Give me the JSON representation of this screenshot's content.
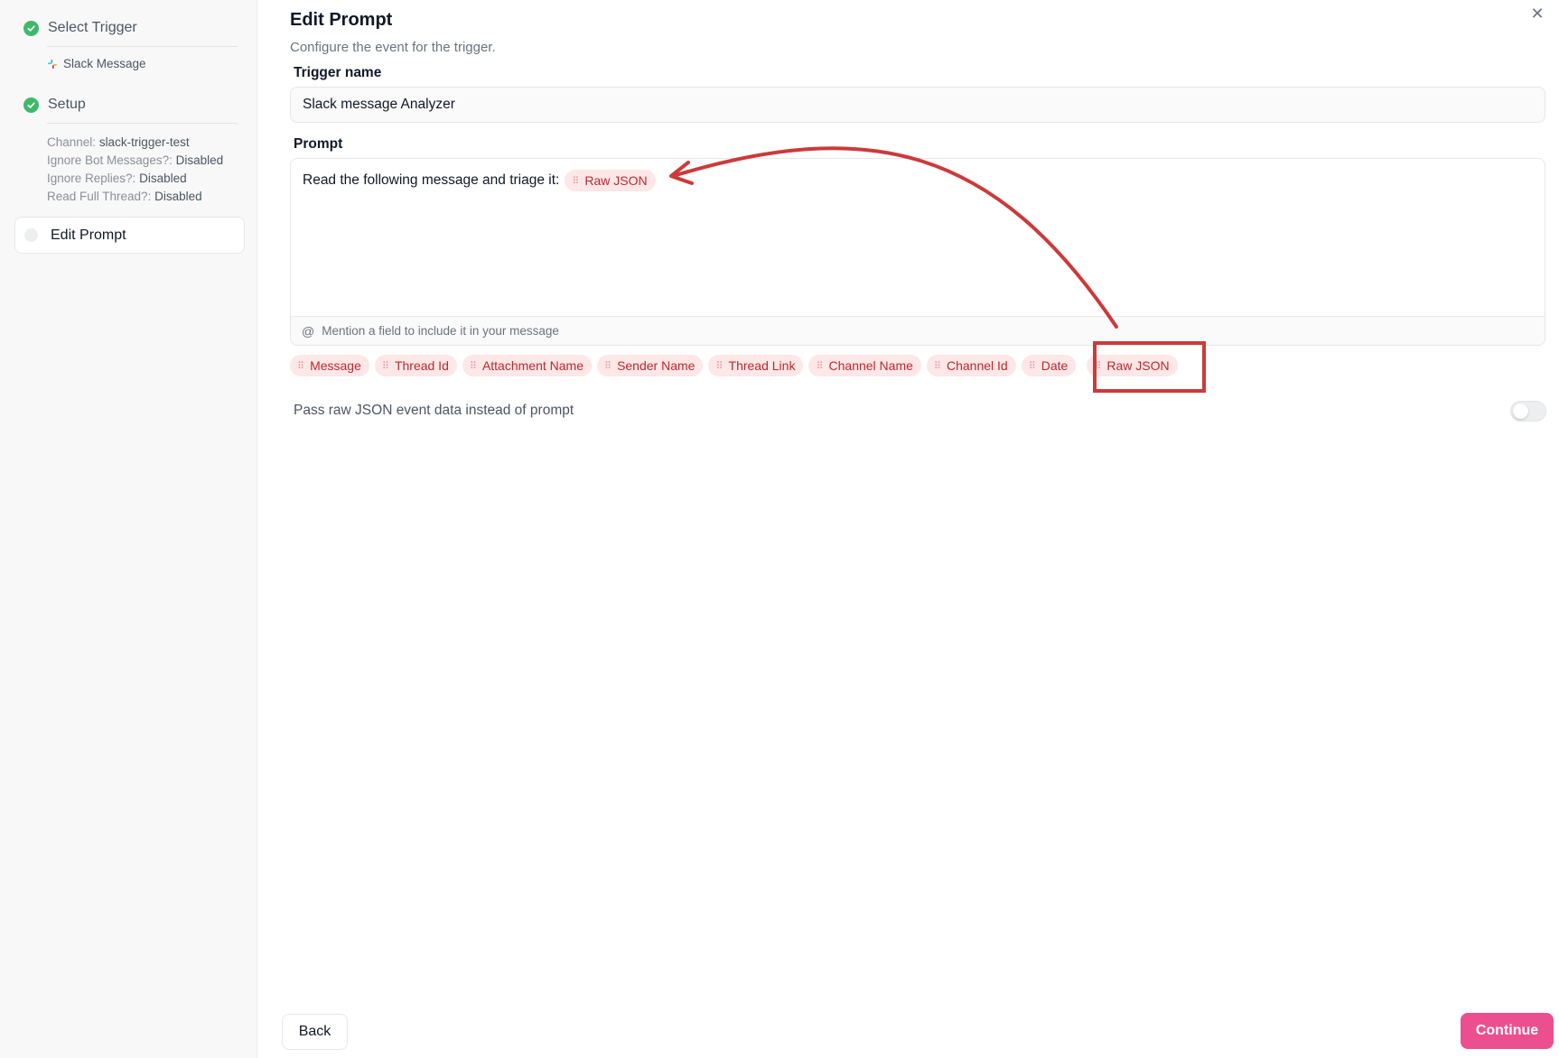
{
  "sidebar": {
    "steps": [
      {
        "label": "Select Trigger",
        "status": "complete"
      },
      {
        "label": "Setup",
        "status": "complete"
      },
      {
        "label": "Edit Prompt",
        "status": "current"
      }
    ],
    "trigger_source": "Slack Message",
    "setup_details": [
      {
        "key": "Channel:",
        "value": "slack-trigger-test"
      },
      {
        "key": "Ignore Bot Messages?:",
        "value": "Disabled"
      },
      {
        "key": "Ignore Replies?:",
        "value": "Disabled"
      },
      {
        "key": "Read Full Thread?:",
        "value": "Disabled"
      }
    ]
  },
  "main": {
    "title": "Edit Prompt",
    "subtitle": "Configure the event for the trigger.",
    "trigger_name_label": "Trigger name",
    "trigger_name_value": "Slack message Analyzer",
    "prompt_label": "Prompt",
    "prompt_text": "Read the following message and triage it:",
    "prompt_inline_chip": "Raw JSON",
    "mention_hint": "Mention a field to include it in your message",
    "field_chips": [
      "Message",
      "Thread Id",
      "Attachment Name",
      "Sender Name",
      "Thread Link",
      "Channel Name",
      "Channel Id",
      "Date",
      "Raw JSON"
    ],
    "toggle_label": "Pass raw JSON event data instead of prompt",
    "toggle_on": false
  },
  "footer": {
    "back_label": "Back",
    "continue_label": "Continue"
  },
  "colors": {
    "accent": "#ec4f8f",
    "chip_text": "#c0262d",
    "chip_bg": "#fde7e7",
    "success": "#3fb86a",
    "annotation": "#cc3a3a"
  }
}
